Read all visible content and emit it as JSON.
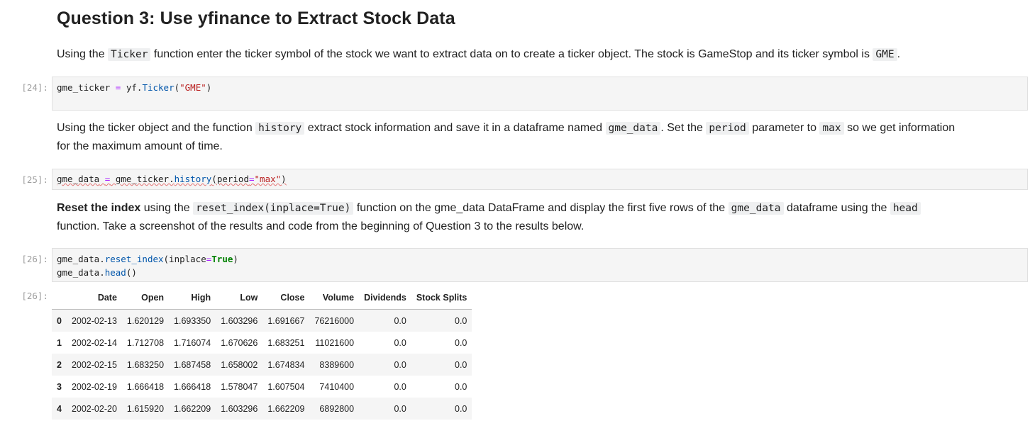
{
  "heading": "Question 3: Use yfinance to Extract Stock Data",
  "para1": {
    "t1": "Using the",
    "c1": "Ticker",
    "t2": "function enter the ticker symbol of the stock we want to extract data on to create a ticker object. The stock is GameStop and its ticker symbol is",
    "c2": "GME",
    "t3": "."
  },
  "cell24": {
    "prompt": "[24]:",
    "var": "gme_ticker",
    "op": "=",
    "obj": "yf.",
    "fn": "Ticker",
    "open": "(",
    "str": "\"GME\"",
    "close": ")"
  },
  "para2": {
    "t1": "Using the ticker object and the function",
    "c1": "history",
    "t2": "extract stock information and save it in a dataframe named",
    "c2": "gme_data",
    "t3": ". Set the",
    "c3": "period",
    "t4": "parameter to",
    "c4": "max",
    "t5": "so we get information",
    "line2": "for the maximum amount of time."
  },
  "cell25": {
    "prompt": "[25]:",
    "var": "gme_data",
    "op": "=",
    "obj": "gme_ticker.",
    "fn": "history",
    "open": "(",
    "param": "period",
    "eq": "=",
    "str": "\"max\"",
    "close": ")"
  },
  "para3": {
    "bold": "Reset the index",
    "t1": "using the",
    "c1": "reset_index(inplace=True)",
    "t2": "function on the gme_data DataFrame and display the first five rows of the",
    "c2": "gme_data",
    "t3": "dataframe using the",
    "c3": "head",
    "line2": "function. Take a screenshot of the results and code from the beginning of Question 3 to the results below."
  },
  "cell26": {
    "prompt": "[26]:",
    "l1_obj": "gme_data.",
    "l1_fn": "reset_index",
    "l1_open": "(inplace",
    "l1_eq": "=",
    "l1_kw": "True",
    "l1_close": ")",
    "l2_obj": "gme_data.",
    "l2_fn": "head",
    "l2_paren": "()"
  },
  "output26": {
    "prompt": "[26]:",
    "columns": [
      "",
      "Date",
      "Open",
      "High",
      "Low",
      "Close",
      "Volume",
      "Dividends",
      "Stock Splits"
    ],
    "rows": [
      [
        "0",
        "2002-02-13",
        "1.620129",
        "1.693350",
        "1.603296",
        "1.691667",
        "76216000",
        "0.0",
        "0.0"
      ],
      [
        "1",
        "2002-02-14",
        "1.712708",
        "1.716074",
        "1.670626",
        "1.683251",
        "11021600",
        "0.0",
        "0.0"
      ],
      [
        "2",
        "2002-02-15",
        "1.683250",
        "1.687458",
        "1.658002",
        "1.674834",
        "8389600",
        "0.0",
        "0.0"
      ],
      [
        "3",
        "2002-02-19",
        "1.666418",
        "1.666418",
        "1.578047",
        "1.607504",
        "7410400",
        "0.0",
        "0.0"
      ],
      [
        "4",
        "2002-02-20",
        "1.615920",
        "1.662209",
        "1.603296",
        "1.662209",
        "6892800",
        "0.0",
        "0.0"
      ]
    ]
  }
}
